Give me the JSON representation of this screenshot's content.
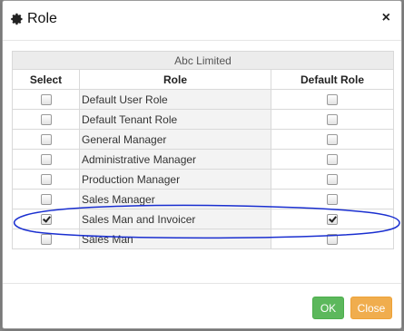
{
  "dialog": {
    "title": "Role",
    "close_glyph": "×",
    "icon": "gear-icon"
  },
  "table": {
    "company": "Abc Limited",
    "headers": {
      "select": "Select",
      "role": "Role",
      "default_role": "Default Role"
    },
    "rows": [
      {
        "role": "Default User Role",
        "select": false,
        "default": false
      },
      {
        "role": "Default Tenant Role",
        "select": false,
        "default": false
      },
      {
        "role": "General Manager",
        "select": false,
        "default": false
      },
      {
        "role": "Administrative Manager",
        "select": false,
        "default": false
      },
      {
        "role": "Production Manager",
        "select": false,
        "default": false
      },
      {
        "role": "Sales Manager",
        "select": false,
        "default": false
      },
      {
        "role": "Sales Man and Invoicer",
        "select": true,
        "default": true
      },
      {
        "role": "Sales Man",
        "select": false,
        "default": false
      }
    ]
  },
  "footer": {
    "ok_label": "OK",
    "close_label": "Close"
  },
  "colors": {
    "ok": "#5cb85c",
    "close": "#f0ad4e",
    "annotation": "#1a2fd0"
  }
}
